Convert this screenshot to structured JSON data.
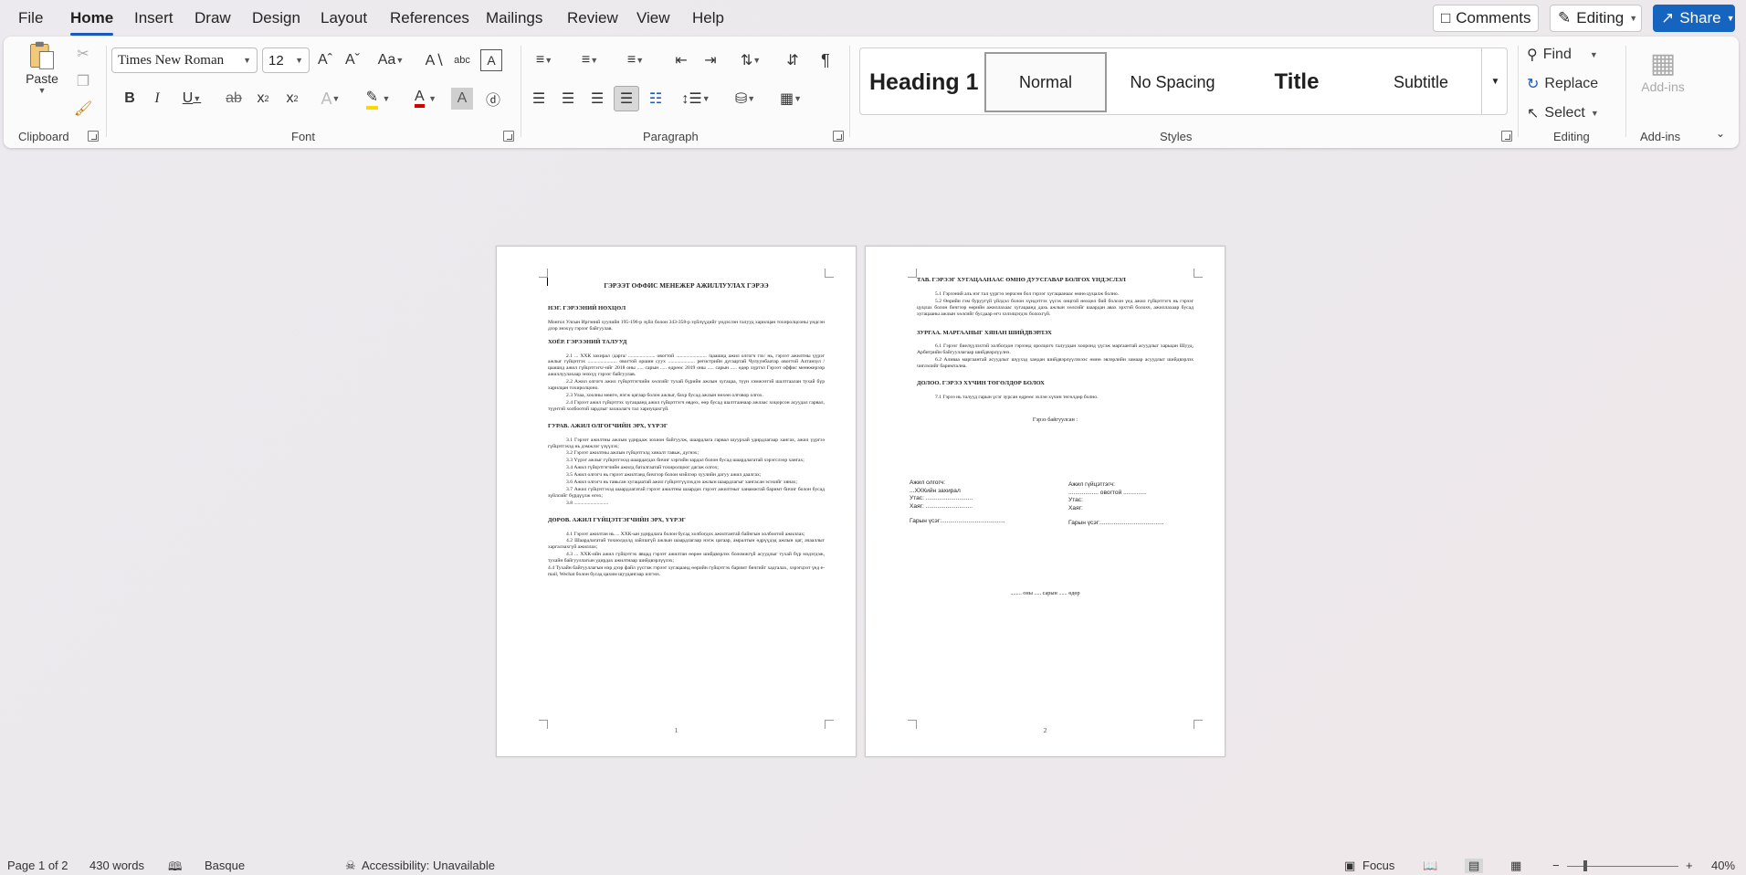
{
  "menu": {
    "tabs": [
      "File",
      "Home",
      "Insert",
      "Draw",
      "Design",
      "Layout",
      "References",
      "Mailings",
      "Review",
      "View",
      "Help"
    ],
    "comments": "Comments",
    "editing": "Editing",
    "share": "Share"
  },
  "ribbon": {
    "clipboard": {
      "paste": "Paste",
      "label": "Clipboard"
    },
    "font": {
      "name": "Times New Roman",
      "size": "12",
      "label": "Font"
    },
    "paragraph": {
      "label": "Paragraph"
    },
    "styles": {
      "label": "Styles",
      "items": [
        "Heading 1",
        "Normal",
        "No Spacing",
        "Title",
        "Subtitle"
      ]
    },
    "editing": {
      "find": "Find",
      "replace": "Replace",
      "select": "Select",
      "label": "Editing"
    },
    "addins": {
      "button": "Add-ins",
      "label": "Add-ins"
    }
  },
  "page1": {
    "title": "ГЭРЭЭТ ОФФИС МЕНЕЖЕР АЖИЛЛУУЛАХ ГЭРЭЭ",
    "s1": "НЭГ. ГЭРЭЭНИЙ НӨХЦӨЛ",
    "s1p": "Монгол Улсын Иргэний хуулийн 195-196-р зүйл болон 343-358-р зүйлүүдийг үндэслэн талууд харилцан тохиролцсоны үндсэн дээр энэхүү гэрээг байгуулав.",
    "s2": "ХОЁР. ГЭРЭЭНИЙ ТАЛУУД",
    "s2p1": "2.1 ... ХХК захирал /дарга/ ..................... овогтой ........................ /цаашид ажил олгогч гэх/ нь, гэрээт ажилтны үүрэг ажлыг гүйцэтгэх ....................... овогтой оршин суух ..................... регистрийн дугаартай Чулуунбаатар овогтой Алтанзул /цаашид ажил гүйцэтгэгч/-ийг 2018 оны ..... сарын ..... өдрөөс 2019 оны ..... сарын ..... өдөр хүртэл Гэрээт оффис менежерээр ажиллуулахаар энэхүү гэрээг байгуулав.",
    "s2p2": "2.2 Ажил олгогч ажил гүйцэтгэгчийн хөлсийг тухай бүрийн ажлын хугацаа, түүн хэмжээтэй шалтгаалан тухай бүр харилцан тохиролцоно.",
    "s2p3": "2.3 Улаа, хоолны мөнгө, нэгж цагаар болон ажлыг, бахр бусад ажлын нөхөн олговор олгох.",
    "s2p4": "2.4 Гэрээт ажил гүйцэтгэх хугацаанд ажил гүйцэтгэгч өвдөх, өөр бусад шалтгаанаар ажлаас хоцорсон асуудал гарвал, түүнтэй холбоотой зардлыг захиалагч тал хариуцахгүй.",
    "s3": "ГУРАВ. АЖИЛ ОЛГОГЧИЙН ЭРХ, ҮҮРЭГ",
    "s3p1": "3.1 Гэрээт ажилтны ажлын үдирдаж зохион байгуулж, шаардлага гарвал шуурхай удирдлагаар хангах, ажил үүргээ гүйцэтгэхэд нь дэмжлэг үзүүлэх;",
    "s3p2": "3.2 Гэрээт ажилтны ажлын гүйцэтгэлд хяналт тавьж, дүгнэх;",
    "s3p3": "3.3 Үүрэг ажлыг гүйцэтгэхэд шаардагдах бичиг хэргийн зардал болон бусад шаардлагатай хэрэгслээр хангах;",
    "s3p4": "3.4 Ажил гүйцэтгэгчийн ажилд баталгаатай тохиролцоог дагаж олгох;",
    "s3p5": "3.5 Ажил олгогч нь гэрээт ажилтанд бичгээр болон мэйлээр хуулийн дагуу ажил даалгах;",
    "s3p6": "3.6 Ажил олгогч нь тавьсан хугацаатай ажил гүйцэтгүүлэхдээ ажлын шаардлагыг хангасан эсэхийг хянах;",
    "s3p7": "3.7 Ажил гүйцэтгэхэд шаардлагатай гэрээт ажилтны шаардах гэрээт ажилтныг ханамжтай баримт бичиг болон бусад зүйлсийг бүрдүүлж өгөх;",
    "s3p8": "3.8 ...........................",
    "s4": "ДӨРӨВ. АЖИЛ ГҮЙЦЭТГЭГЧИЙН ЭРХ, ҮҮРЭГ",
    "s4p1": "4.1 Гэрээт ажилтан нь ... ХХК-ын удирдлага болон бусад холбогдох ажилтантай байнгын холбоотой ажиллах;",
    "s4p2": "4.2 Шаардлагатай тохиолдолд зайлшгүй ажлын шаардлагаар нэгж цагаар, амралтын өдрүүдэд ажлын цаг, ачааллыг харгалзахгүй ажиллах;",
    "s4p3": "4.3 ... ХХК-ийн ажил гүйцэтгэх явцад гэрээт ажилтан өөрөө шийдвэрлэх боломжгүй асуудлыг тухай бүр мэдэгдэж, тухайн байгууллагын удирдах ажилтнаар шийдвэрлүүлэх;",
    "s4p4": "4.4 Тухайн байгууллагын нэр дээр файл үүсгэж гэрээт хугацаанд өөрийн гүйцэтгэх баримт бичгийг хадгалах, хэрэгцээт үед e-mail, Wechat болон бусад цахим шуудангаар илгээх.",
    "num": "1"
  },
  "page2": {
    "s5": "ТАВ. ГЭРЭЭГ ХУГАЦААНААС ӨМНӨ ДУУСГАВАР БОЛГОХ ҮНДЭСЛЭЛ",
    "s5p1": "5.1 Гэрээний аль нэг тал үүргээ зөрчсөн бол гэрээг хугацаанаас өмнө цуцалж болно.",
    "s5p2": "5.2 Өөрийн гэм буруугүй үйлдэл болон хүндэтгэх үүсэх онцгой нөхцөл бий болсон үед ажил гүйцэтгэгч нь гэрээг цуцлах болон бичгээр өөрийн ажиллахаас хугацаанд дахь ажлын хөлсийг шаардан авах эрхтэй болохч, ажиллахаар бусад хугацааны ажлын хөлсийг бусдаар өгч хэлэлцэгдэх болохгүй.",
    "s6": "ЗУРГАА. МАРГААНЫГ ХЯНАН ШИЙДВЭРЛЭХ",
    "s6p1": "6.1 Гэрээг биелүүлэхтэй холбогдон гэрээнд оролцогч талуудын хооронд үүсэж маргаантай асуудлыг харьцан Шууд, Арбитрийн байгууллагаар шийдвэрлүүлнэ.",
    "s6p2": "6.2 Аливаа маргаантай асуудлыг шүүхэд хандан шийдвэрлүүлэхээс өмнө эвлэрлийн замаар асуудлыг шийдвэрлэх чиглэлийг баримтална.",
    "s7": "ДОЛОО. ГЭРЭЭ ХҮЧИН ТӨГӨЛДӨР БОЛОХ",
    "s7p1": "7.1 Гэрээ нь талууд гарын үсэг зурсан өдрөөс эхлэн хүчин төгөлдөр болно.",
    "made": "Гэрээ байгуулсан :",
    "left_sig": [
      "Ажил олгогч:",
      "...ХХКийн захирал",
      "Утас: ............................",
      "Хаяг: ............................",
      "",
      "Гарын үсэг:......................................"
    ],
    "right_sig": [
      "Ажил гүйцэтгэгч:",
      ".................. овогтой ..............",
      "Утас:",
      "Хаяг:",
      "",
      "Гарын үсэг:......................................"
    ],
    "date": "........ оны ..... сарын ...... өдөр",
    "num": "2"
  },
  "status": {
    "page": "Page 1 of 2",
    "words": "430 words",
    "language": "Basque",
    "accessibility": "Accessibility: Unavailable",
    "focus": "Focus",
    "zoom": "40%"
  }
}
